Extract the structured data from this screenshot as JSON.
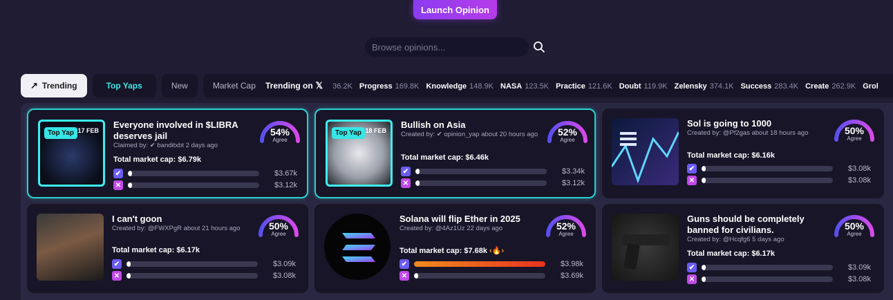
{
  "launch_label": "Launch Opinion",
  "search": {
    "placeholder": "Browse opinions..."
  },
  "tabs": [
    {
      "label": "Trending"
    },
    {
      "label": "Top Yaps"
    },
    {
      "label": "New"
    },
    {
      "label": "Market Cap"
    }
  ],
  "ticker": {
    "title": "Trending on",
    "items": [
      {
        "kw": "",
        "count": "36.2K"
      },
      {
        "kw": "Progress",
        "count": "169.8K"
      },
      {
        "kw": "Knowledge",
        "count": "148.9K"
      },
      {
        "kw": "NASA",
        "count": "123.5K"
      },
      {
        "kw": "Practice",
        "count": "121.6K"
      },
      {
        "kw": "Doubt",
        "count": "119.9K"
      },
      {
        "kw": "Zelensky",
        "count": "374.1K"
      },
      {
        "kw": "Success",
        "count": "283.4K"
      },
      {
        "kw": "Create",
        "count": "262.9K"
      },
      {
        "kw": "Grol",
        "count": ""
      }
    ]
  },
  "agree_label": "Agree",
  "cards": [
    {
      "title": "Everyone involved in $LIBRA deserves jail",
      "meta": "Claimed by: ✔ banditxbt 2 days ago",
      "cap": "Total market cap: $6.79k",
      "badge": "Top Yap",
      "date": "17 FEB",
      "pct": "54%",
      "agree_fraction": 0.54,
      "yes_amt": "$3.67k",
      "no_amt": "$3.12k",
      "yes_fill": 0.03,
      "no_fill": 0.02
    },
    {
      "title": "Bullish on Asia",
      "meta": "Created by: ✔ opinion_yap about 20 hours ago",
      "cap": "Total market cap: $6.46k",
      "badge": "Top Yap",
      "date": "18 FEB",
      "pct": "52%",
      "agree_fraction": 0.52,
      "yes_amt": "$3.34k",
      "no_amt": "$3.12k",
      "yes_fill": 0.02,
      "no_fill": 0.02
    },
    {
      "title": "Sol is going to 1000",
      "meta": "Created by: @Pf2gas about 18 hours ago",
      "cap": "Total market cap: $6.16k",
      "pct": "50%",
      "agree_fraction": 0.5,
      "yes_amt": "$3.08k",
      "no_amt": "$3.08k",
      "yes_fill": 0.01,
      "no_fill": 0.01
    },
    {
      "title": "I can't goon",
      "meta": "Created by: @FWXPgR about 21 hours ago",
      "cap": "Total market cap: $6.17k",
      "pct": "50%",
      "agree_fraction": 0.5,
      "yes_amt": "$3.09k",
      "no_amt": "$3.08k",
      "yes_fill": 0.01,
      "no_fill": 0.01
    },
    {
      "title": "Solana will flip Ether in 2025",
      "meta": "Created by: @4Az1Uz 22 days ago",
      "cap": "Total market cap: $7.68k",
      "pct": "52%",
      "agree_fraction": 0.52,
      "yes_amt": "$3.98k",
      "no_amt": "$3.69k",
      "yes_fill": 1.0,
      "no_fill": 0.03
    },
    {
      "title": "Guns should be completely banned for civilians.",
      "meta": "Created by: @Hcqfg6 5 days ago",
      "cap": "Total market cap: $6.17k",
      "pct": "50%",
      "agree_fraction": 0.5,
      "yes_amt": "$3.09k",
      "no_amt": "$3.08k",
      "yes_fill": 0.01,
      "no_fill": 0.01
    }
  ],
  "colors": {
    "accent": "#8b3cf0",
    "cyan": "#2ad1d1",
    "gauge_start": "#5a4ef0",
    "gauge_end": "#d84ae8"
  }
}
